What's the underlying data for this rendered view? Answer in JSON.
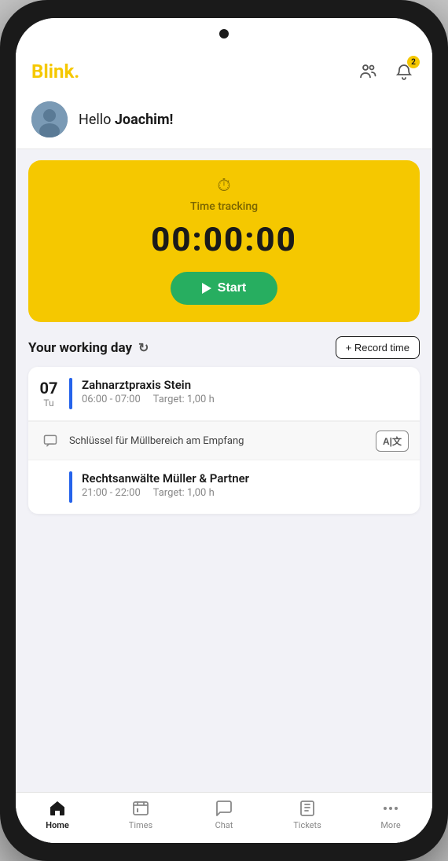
{
  "app": {
    "logo": "Blink",
    "logo_dot": "."
  },
  "header": {
    "avatar_emoji": "👤",
    "team_icon_label": "team-icon",
    "notification_icon_label": "notification-icon",
    "notification_count": "2"
  },
  "greeting": {
    "text": "Hello ",
    "name": "Joachim!"
  },
  "time_tracking": {
    "label": "Time tracking",
    "display": "00:00:00",
    "start_button": "Start"
  },
  "working_day": {
    "title": "Your working day",
    "record_button": "+ Record time"
  },
  "schedule": [
    {
      "date_num": "07",
      "date_day": "Tu",
      "name": "Zahnarztpraxis Stein",
      "time": "06:00 - 07:00",
      "target": "Target: 1,00 h"
    },
    {
      "date_num": "",
      "date_day": "",
      "name": "Rechtsanwälte Müller & Partner",
      "time": "21:00 - 22:00",
      "target": "Target: 1,00 h"
    }
  ],
  "message": {
    "text": "Schlüssel für Müllbereich am Empfang",
    "translate_label": "A|文"
  },
  "nav": {
    "items": [
      {
        "label": "Home",
        "icon": "home",
        "active": true
      },
      {
        "label": "Times",
        "icon": "times",
        "active": false
      },
      {
        "label": "Chat",
        "icon": "chat",
        "active": false
      },
      {
        "label": "Tickets",
        "icon": "tickets",
        "active": false
      },
      {
        "label": "More",
        "icon": "more",
        "active": false
      }
    ]
  }
}
